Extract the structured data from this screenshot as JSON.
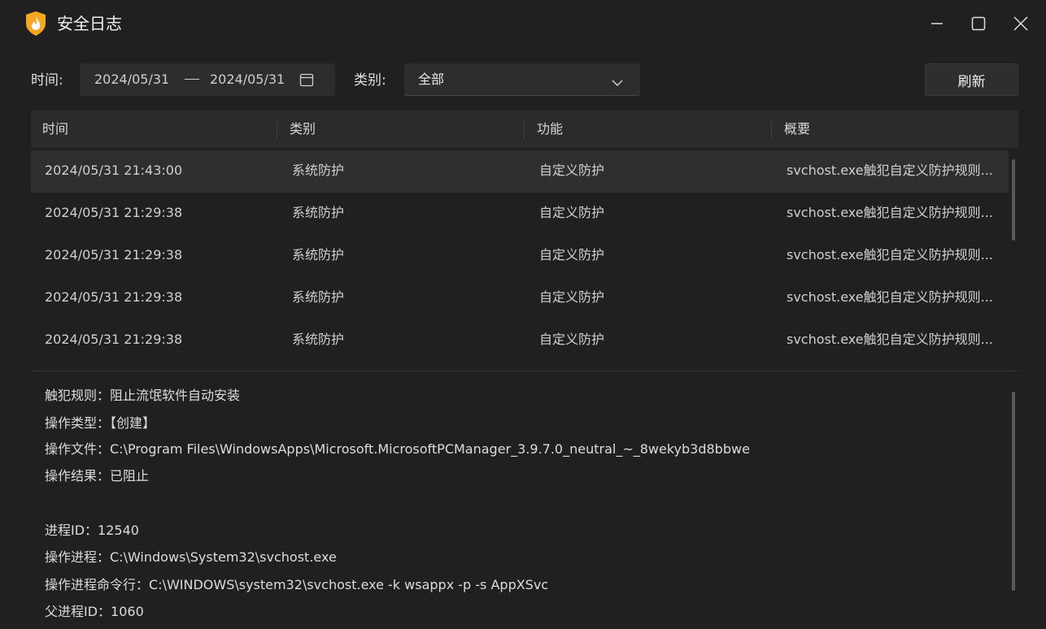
{
  "window": {
    "title": "安全日志",
    "app_icon": "flame-shield-icon",
    "controls": [
      "minimize-icon",
      "maximize-icon",
      "close-icon"
    ]
  },
  "filters": {
    "time_label": "时间:",
    "date_start": "2024/05/31",
    "date_end": "2024/05/31",
    "category_label": "类别:",
    "category_value": "全部",
    "refresh_label": "刷新"
  },
  "table": {
    "columns": [
      "时间",
      "类别",
      "功能",
      "概要"
    ],
    "rows": [
      {
        "time": "2024/05/31 21:43:00",
        "category": "系统防护",
        "function": "自定义防护",
        "summary": "svchost.exe触犯自定义防护规则..."
      },
      {
        "time": "2024/05/31 21:29:38",
        "category": "系统防护",
        "function": "自定义防护",
        "summary": "svchost.exe触犯自定义防护规则..."
      },
      {
        "time": "2024/05/31 21:29:38",
        "category": "系统防护",
        "function": "自定义防护",
        "summary": "svchost.exe触犯自定义防护规则..."
      },
      {
        "time": "2024/05/31 21:29:38",
        "category": "系统防护",
        "function": "自定义防护",
        "summary": "svchost.exe触犯自定义防护规则..."
      },
      {
        "time": "2024/05/31 21:29:38",
        "category": "系统防护",
        "function": "自定义防护",
        "summary": "svchost.exe触犯自定义防护规则..."
      }
    ]
  },
  "details": {
    "lines": [
      "触犯规则：阻止流氓软件自动安装",
      "操作类型：【创建】",
      "操作文件：C:\\Program Files\\WindowsApps\\Microsoft.MicrosoftPCManager_3.9.7.0_neutral_~_8wekyb3d8bbwe",
      "操作结果：已阻止",
      "",
      "进程ID：12540",
      "操作进程：C:\\Windows\\System32\\svchost.exe",
      "操作进程命令行：C:\\WINDOWS\\system32\\svchost.exe -k wsappx -p -s AppXSvc",
      "父进程ID：1060"
    ]
  },
  "colors": {
    "background": "#202020",
    "accent_flame": "#f5a623"
  }
}
